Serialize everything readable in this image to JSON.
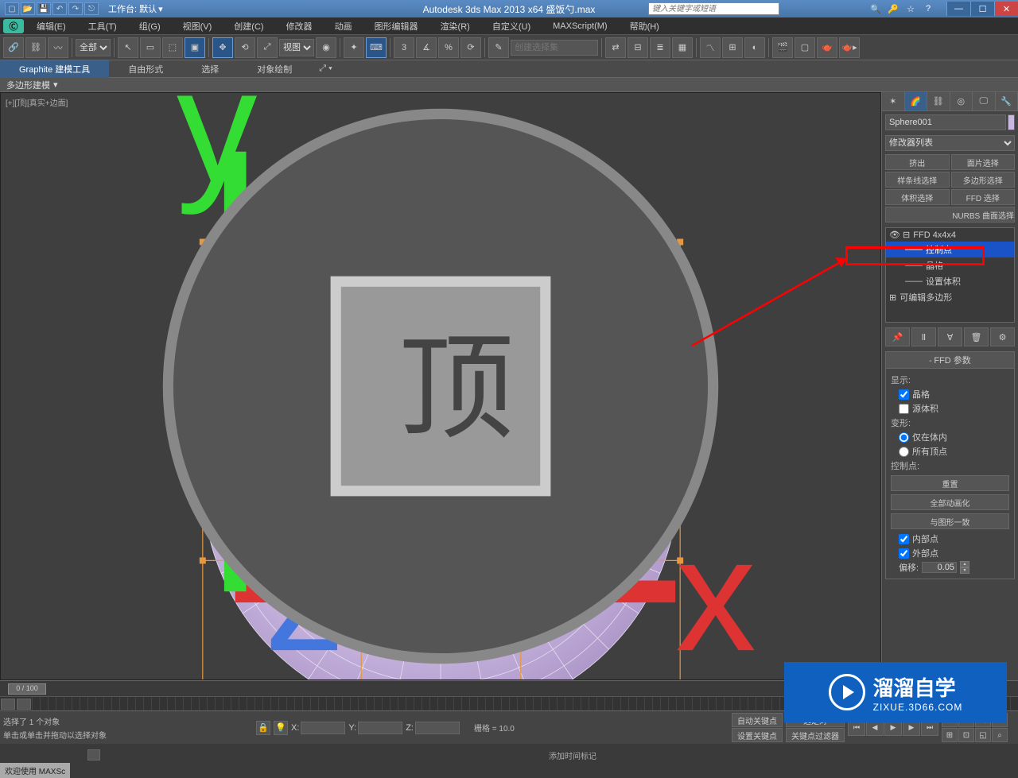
{
  "titlebar": {
    "workspace_label": "工作台: 默认",
    "app_title": "Autodesk 3ds Max  2013 x64    盛饭勺.max",
    "search_placeholder": "键入关键字或短语"
  },
  "menus": [
    "编辑(E)",
    "工具(T)",
    "组(G)",
    "视图(V)",
    "创建(C)",
    "修改器",
    "动画",
    "图形编辑器",
    "渲染(R)",
    "自定义(U)",
    "MAXScript(M)",
    "帮助(H)"
  ],
  "toolbar": {
    "filter_all": "全部",
    "view_dropdown": "视图",
    "selset_placeholder": "创建选择集"
  },
  "ribbon": {
    "tabs": [
      "Graphite 建模工具",
      "自由形式",
      "选择",
      "对象绘制"
    ],
    "subtab": "多边形建模"
  },
  "viewport": {
    "label": "[+][顶][真实+边面]"
  },
  "cmdpanel": {
    "object_name": "Sphere001",
    "modifier_list_label": "修改器列表",
    "buttons": [
      "挤出",
      "面片选择",
      "样条线选择",
      "多边形选择",
      "体积选择",
      "FFD 选择"
    ],
    "nurbs_label": "NURBS 曲面选择",
    "stack": {
      "ffd": "FFD 4x4x4",
      "ctrl_points": "控制点",
      "lattice": "晶格",
      "set_volume": "设置体积",
      "editable_poly": "可编辑多边形"
    },
    "rollout_title": "FFD 参数",
    "display_label": "显示:",
    "lattice_cb": "晶格",
    "source_vol_cb": "源体积",
    "deform_label": "变形:",
    "in_vol_rb": "仅在体内",
    "all_verts_rb": "所有顶点",
    "ctrl_pts_label": "控制点:",
    "reset_btn": "重置",
    "animate_all_btn": "全部动画化",
    "fit_shape_btn": "与图形一致",
    "inside_pts_cb": "内部点",
    "outside_pts_cb": "外部点",
    "offset_label": "偏移:",
    "offset_val": "0.05"
  },
  "timeline": {
    "frame": "0 / 100"
  },
  "status": {
    "selection_text": "选择了 1 个对象",
    "hint_text": "单击或单击并拖动以选择对象",
    "welcome": "欢迎使用  MAXSc",
    "x_label": "X:",
    "y_label": "Y:",
    "z_label": "Z:",
    "grid_label": "栅格 = 10.0",
    "add_time_tag": "添加时间标记",
    "autokey": "自动关键点",
    "setkey": "设置关键点",
    "sel_locked": "选定对",
    "key_filters": "关键点过滤器"
  },
  "watermark": {
    "main": "溜溜自学",
    "sub": "ZIXUE.3D66.COM"
  }
}
